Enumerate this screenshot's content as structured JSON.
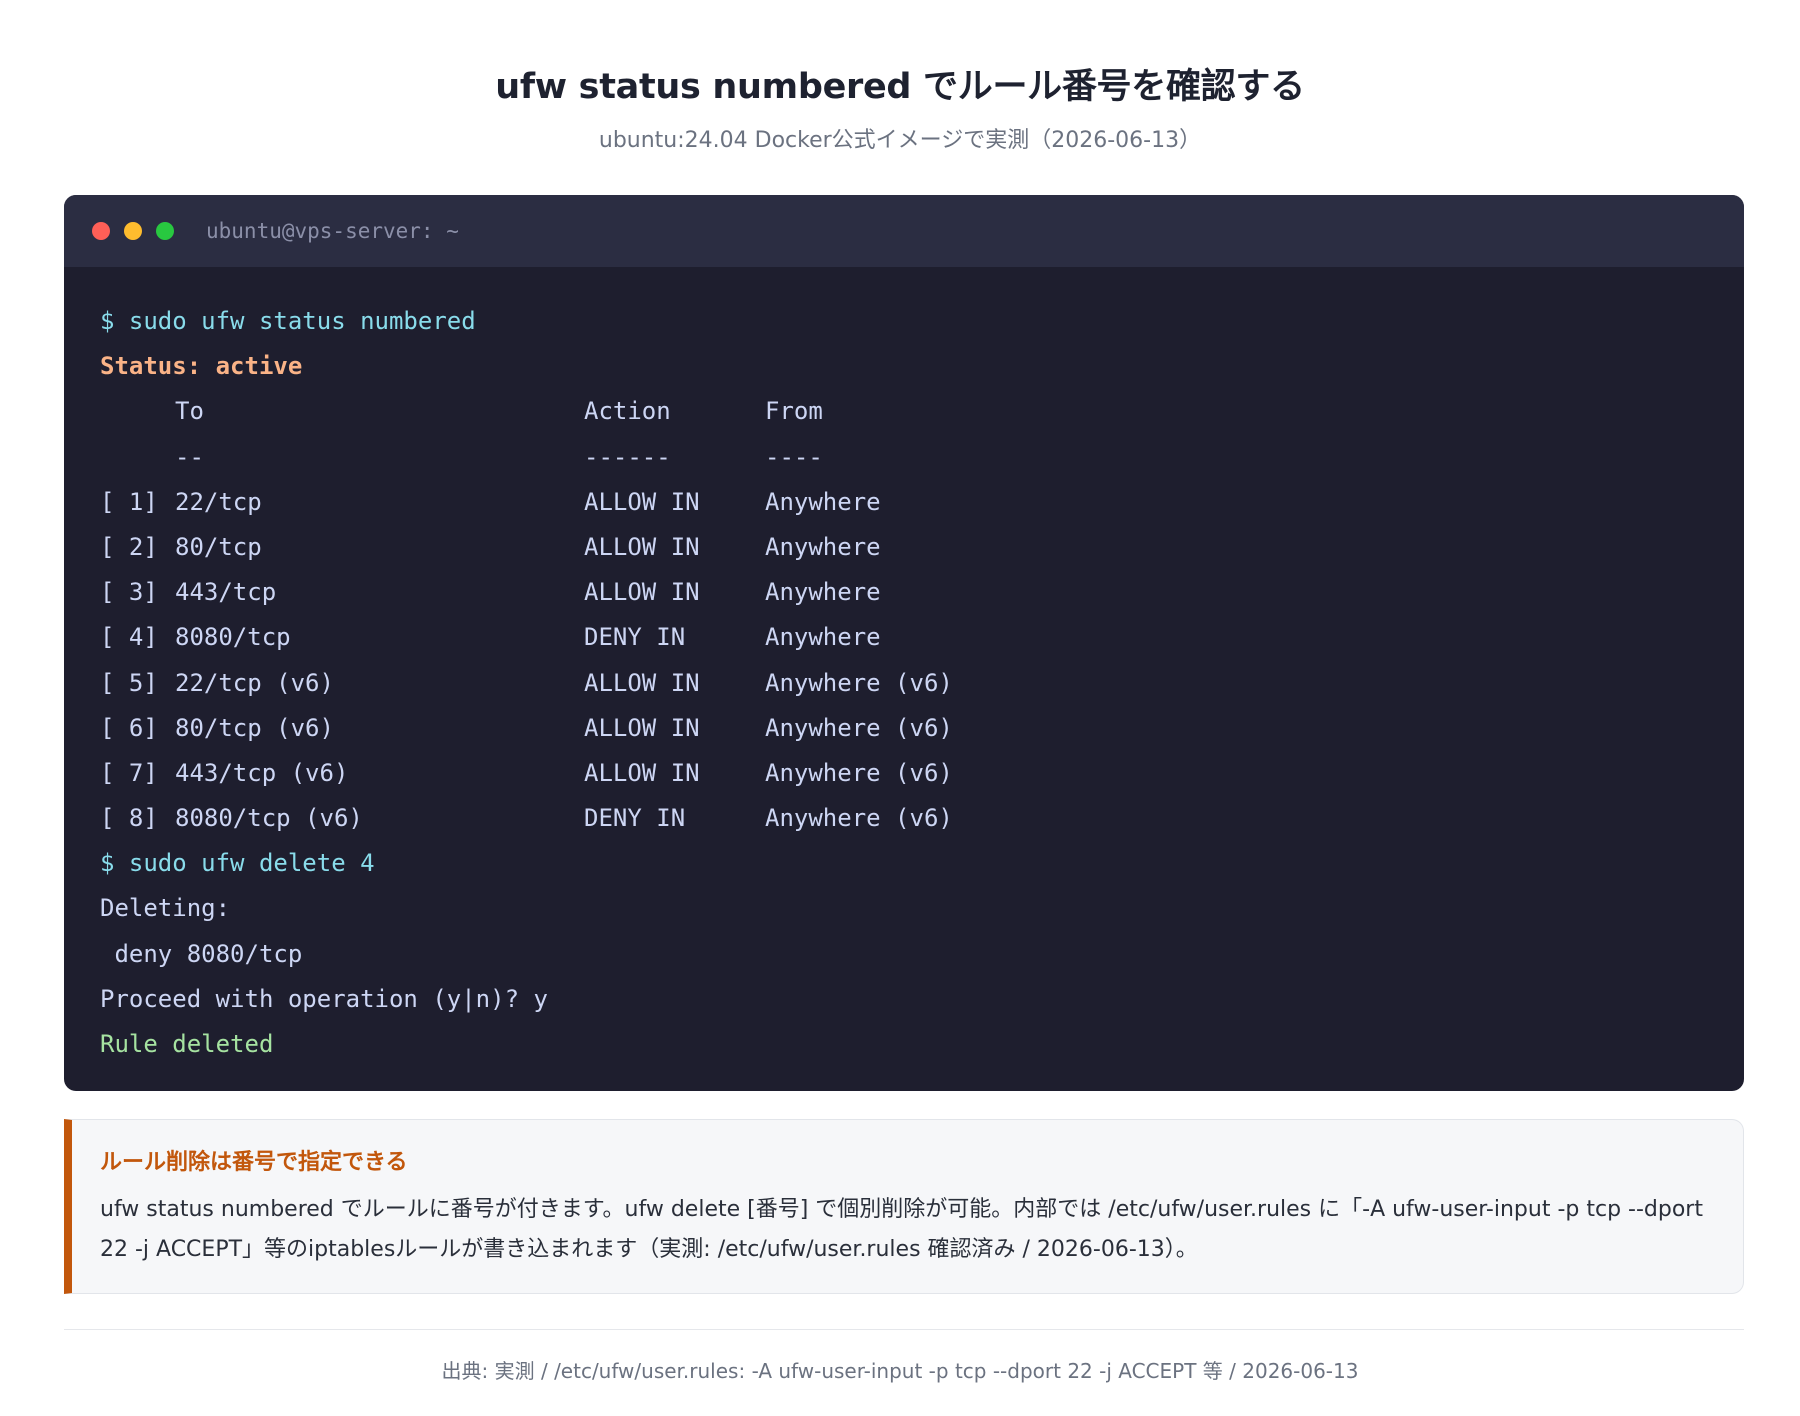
{
  "header": {
    "title": "ufw status numbered でルール番号を確認する",
    "subtitle": "ubuntu:24.04 Docker公式イメージで実測（2026-06-13）"
  },
  "terminal": {
    "title": "ubuntu@vps-server: ~",
    "command1": "$ sudo ufw status numbered",
    "status": "Status: active",
    "columns": {
      "to": "To",
      "action": "Action",
      "from": "From"
    },
    "underlines": {
      "to": "--",
      "action": "------",
      "from": "----"
    },
    "rules": [
      {
        "num": "[ 1]",
        "to": "22/tcp",
        "action": "ALLOW IN",
        "from": "Anywhere"
      },
      {
        "num": "[ 2]",
        "to": "80/tcp",
        "action": "ALLOW IN",
        "from": "Anywhere"
      },
      {
        "num": "[ 3]",
        "to": "443/tcp",
        "action": "ALLOW IN",
        "from": "Anywhere"
      },
      {
        "num": "[ 4]",
        "to": "8080/tcp",
        "action": "DENY IN",
        "from": "Anywhere"
      },
      {
        "num": "[ 5]",
        "to": "22/tcp (v6)",
        "action": "ALLOW IN",
        "from": "Anywhere (v6)"
      },
      {
        "num": "[ 6]",
        "to": "80/tcp (v6)",
        "action": "ALLOW IN",
        "from": "Anywhere (v6)"
      },
      {
        "num": "[ 7]",
        "to": "443/tcp (v6)",
        "action": "ALLOW IN",
        "from": "Anywhere (v6)"
      },
      {
        "num": "[ 8]",
        "to": "8080/tcp (v6)",
        "action": "DENY IN",
        "from": "Anywhere (v6)"
      }
    ],
    "command2": "$ sudo ufw delete 4",
    "deleting": "Deleting:",
    "deleted_rule": " deny 8080/tcp",
    "proceed": "Proceed with operation (y|n)? y",
    "result": "Rule deleted"
  },
  "callout": {
    "title": "ルール削除は番号で指定できる",
    "body": "ufw status numbered でルールに番号が付きます。ufw delete [番号] で個別削除が可能。内部では /etc/ufw/user.rules に「-A ufw-user-input -p tcp --dport 22 -j ACCEPT」等のiptablesルールが書き込まれます（実測: /etc/ufw/user.rules 確認済み / 2026-06-13）。"
  },
  "footer": {
    "text": "出典: 実測 / /etc/ufw/user.rules: -A ufw-user-input -p tcp --dport 22 -j ACCEPT 等 / 2026-06-13"
  },
  "colors": {
    "terminal_bg": "#1e1e2e",
    "titlebar_bg": "#2b2d42",
    "command": "#89dceb",
    "status": "#fab387",
    "success": "#a6e3a1",
    "accent": "#c2570c"
  }
}
